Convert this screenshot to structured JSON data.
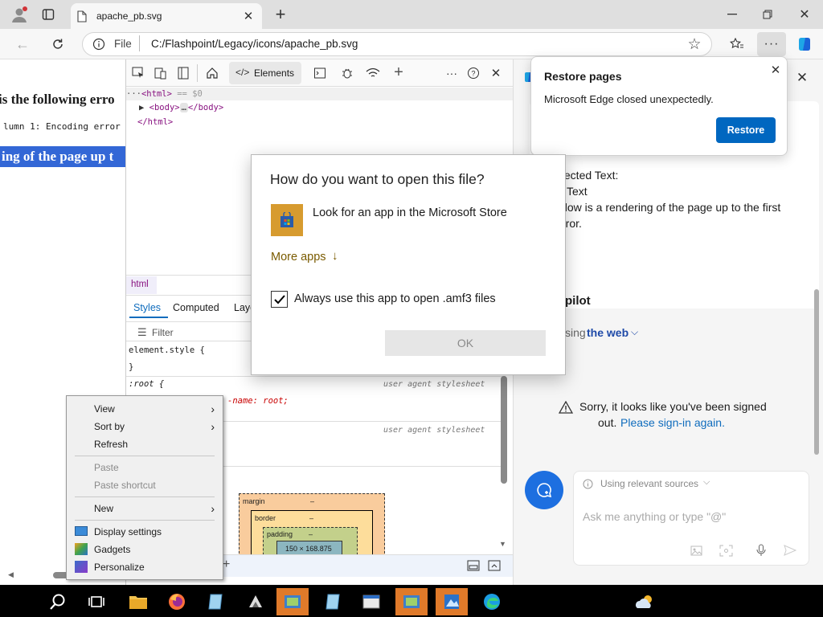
{
  "browser": {
    "tab_title": "apache_pb.svg",
    "address_label": "File",
    "address_url": "C:/Flashpoint/Legacy/icons/apache_pb.svg"
  },
  "page": {
    "error_heading": "is the following erro",
    "error_detail": "lumn 1: Encoding error",
    "render_heading": "ing of the page up t"
  },
  "devtools": {
    "tabs": {
      "elements": "Elements"
    },
    "dom": {
      "html_open": "<html>",
      "html_marker": "== $0",
      "body": "<body>",
      "body_ellipsis": "…",
      "body_close": "</body>",
      "html_close": "</html>"
    },
    "breadcrumb": "html",
    "style_tabs": [
      "Styles",
      "Computed",
      "Layo"
    ],
    "filter_placeholder": "Filter",
    "rules": {
      "element_style": "element.style {",
      "close_brace": "}",
      "root_selector": ":root {",
      "ua_sheet_1": "user agent stylesheet",
      "root_prop": "-name: root;",
      "ua_sheet_2": "user agent stylesheet"
    },
    "boxmodel": {
      "margin_label": "margin",
      "margin_value": "–",
      "border_label": "border",
      "border_value": "–",
      "padding_label": "padding",
      "padding_value": "–",
      "content_size": "150 × 168.875"
    }
  },
  "restore": {
    "title": "Restore pages",
    "message": "Microsoft Edge closed unexpectedly.",
    "button": "Restore"
  },
  "copilot": {
    "selected_label": "elected Text:",
    "selected_type": "Text",
    "selected_body_1": "elow is a rendering of the page up to the first",
    "selected_body_2": "rror.",
    "heading": "pilot",
    "using_prefix": "sing",
    "using_link": "the web",
    "signed_out_1": "Sorry, it looks like you've been signed",
    "signed_out_2": "out.",
    "signin_link": "Please sign-in again.",
    "sources_label": "Using relevant sources",
    "input_placeholder": "Ask me anything or type \"@\""
  },
  "open_with": {
    "title": "How do you want to open this file?",
    "store_option": "Look for an app in the Microsoft Store",
    "more_apps": "More apps",
    "always_use": "Always use this app to open .amf3 files",
    "always_checked": true,
    "ok_button": "OK"
  },
  "context_menu": {
    "items": [
      {
        "label": "View",
        "submenu": true
      },
      {
        "label": "Sort by",
        "submenu": true
      },
      {
        "label": "Refresh"
      },
      {
        "label": "Paste",
        "disabled": true
      },
      {
        "label": "Paste shortcut",
        "disabled": true
      },
      {
        "label": "New",
        "submenu": true
      },
      {
        "label": "Display settings"
      },
      {
        "label": "Gadgets"
      },
      {
        "label": "Personalize"
      }
    ]
  },
  "colors": {
    "accent": "#0067c0",
    "link": "#0f6cbd",
    "selection": "#3367d6",
    "taskbar_active": "#e07a2a",
    "copilot_button": "#1d6fe0"
  }
}
